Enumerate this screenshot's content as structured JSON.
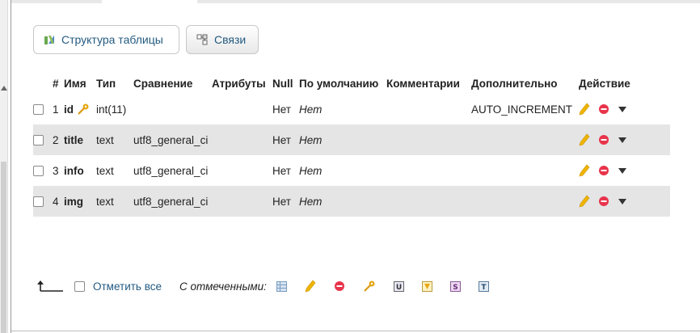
{
  "tabs": [
    {
      "label": "Структура таблицы",
      "icon": "table-structure-icon"
    },
    {
      "label": "Связи",
      "icon": "relations-icon"
    }
  ],
  "table": {
    "headers": [
      "#",
      "Имя",
      "Тип",
      "Сравнение",
      "Атрибуты",
      "Null",
      "По умолчанию",
      "Комментарии",
      "Дополнительно",
      "Действие"
    ],
    "rows": [
      {
        "num": "1",
        "name": "id",
        "primary_key": true,
        "type": "int(11)",
        "collation": "",
        "attributes": "",
        "null": "Нет",
        "default": "Нет",
        "comments": "",
        "extra": "AUTO_INCREMENT"
      },
      {
        "num": "2",
        "name": "title",
        "primary_key": false,
        "type": "text",
        "collation": "utf8_general_ci",
        "attributes": "",
        "null": "Нет",
        "default": "Нет",
        "comments": "",
        "extra": ""
      },
      {
        "num": "3",
        "name": "info",
        "primary_key": false,
        "type": "text",
        "collation": "utf8_general_ci",
        "attributes": "",
        "null": "Нет",
        "default": "Нет",
        "comments": "",
        "extra": ""
      },
      {
        "num": "4",
        "name": "img",
        "primary_key": false,
        "type": "text",
        "collation": "utf8_general_ci",
        "attributes": "",
        "null": "Нет",
        "default": "Нет",
        "comments": "",
        "extra": ""
      }
    ],
    "row_actions": [
      "edit-pencil-icon",
      "drop-icon",
      "more-dropdown-icon"
    ]
  },
  "footer": {
    "check_all_label": "Отметить все",
    "with_selected_label": "С отмеченными:",
    "bulk_actions": [
      "browse-icon",
      "edit-pencil-icon",
      "drop-icon",
      "primary-key-icon",
      "unique-icon",
      "index-icon",
      "spatial-icon",
      "fulltext-icon"
    ]
  },
  "colors": {
    "link": "#235a81",
    "alt_row": "#e5e5e5",
    "drop": "#e8344b",
    "pencil": "#f0b400",
    "key": "#e6a817"
  }
}
